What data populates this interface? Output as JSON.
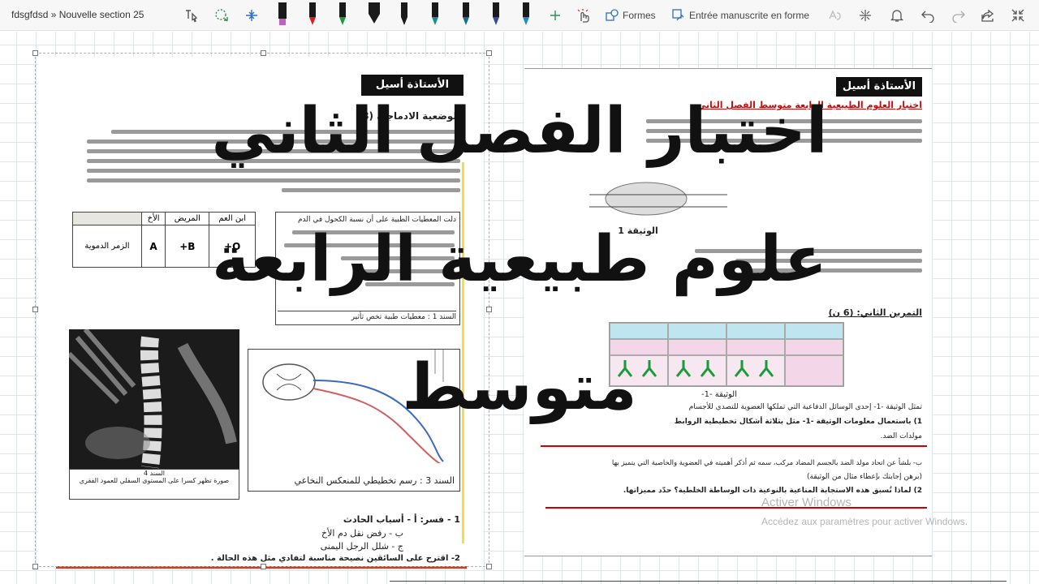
{
  "toolbar": {
    "breadcrumb": "fdsgfdsd » Nouvelle section 25",
    "shapes_label": "Formes",
    "handwriting_label": "Entrée manuscrite en forme",
    "pen_colors": [
      "#1a1a1a",
      "#d62020",
      "#1a9a3a",
      "#1a1a1a",
      "#1a1a1a",
      "#1a8a9a",
      "#1a6a8a",
      "#3a4aa0",
      "#1a8ac8"
    ],
    "highlighter_color": "#c060c0",
    "accent_color": "#2f6fbf"
  },
  "left_page": {
    "badge": "الأستاذة أسيل",
    "heading": "الوضعية الادماجية (8",
    "table": {
      "headers": [
        "ابن العم",
        "المريض",
        "الأخ",
        ""
      ],
      "row_label": "الزمر الدموية",
      "values": [
        "O+",
        "B+",
        "A"
      ]
    },
    "box_title": "دلت المعطيات الطبية على أن نسبة الكحول في الدم",
    "box_caption": "السند 1 : معطيات طبية تخص تأثير",
    "xray_caption": "السند 4",
    "xray_subcaption": "صورة تظهر كسرا على المستوى السفلي للعمود الفقري",
    "diagram_caption": "السند 3 : رسم تخطيطي للمنعكس النخاعي",
    "q1": "1 -  فسر: أ - أسباب الحادث",
    "q1b": "ب - رفض نقل دم الأخ",
    "q1c": "ج - شلل الرجل اليمنى",
    "q2": "2- اقترح على السائقين نصيحة مناسبة لتفادي مثل هذه الحالة ."
  },
  "right_page": {
    "badge": "الأستاذة أسيل",
    "title": "اختبار العلوم الطبيعية الرابعة متوسط الفصل الثاني",
    "doc1_caption": "الوثيقة 1",
    "ex2_title": "التمرين الثاني: (6 ن)",
    "doc_1_caption": "الوثيقة -1-",
    "p1": "تمثل الوثيقة -1- إحدى الوسائل الدفاعية التي تملكها العضوية للتصدي للأجسام",
    "p2": "1) باستعمال معلومات الوثيقة -1- مثل بثلاثة أشكال تخطيطية الروابط",
    "p3": "مولدات الضد.",
    "p4": "ب- بلشأ عن اتحاد مولد الضد بالجسم المضاد مركب، سمه ثم أذكر أهميته في العضوية والخاصية التي يتميز بها",
    "p5": "(برهن إجابتك بإعطاء مثال من الوثيقة)",
    "p6": "2) لماذا تُسبق هذه الاستجابة المناعية بالنوعية ذات الوساطة الخلطية؟ حدّد مميزاتها."
  },
  "ink": {
    "line1": "اختبار الفصل الثاني",
    "line2": "علوم طبيعية الرابعة",
    "line3": "متوسط"
  },
  "watermark": {
    "title": "Activer Windows",
    "subtitle": "Accédez aux paramètres pour activer Windows."
  }
}
